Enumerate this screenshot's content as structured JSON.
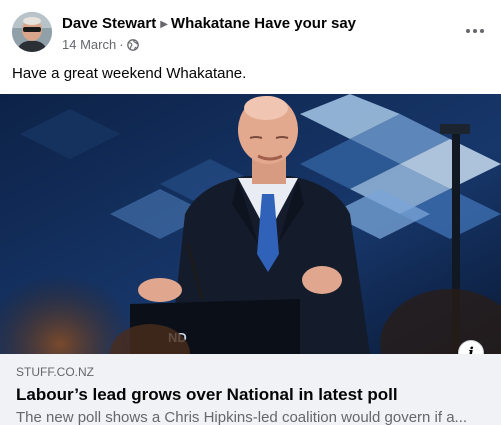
{
  "post": {
    "author": "Dave Stewart",
    "group": "Whakatane Have your say",
    "date": "14 March",
    "separator": "·",
    "privacy_icon": "globe-icon",
    "text": "Have a great weekend Whakatane."
  },
  "link_preview": {
    "domain": "STUFF.CO.NZ",
    "title": "Labour’s lead grows over National in latest poll",
    "description": "The new poll shows a Chris Hipkins-led coalition would govern if a...",
    "image_caption": "ND"
  },
  "icons": {
    "more": "more-options-icon",
    "info": "info-icon"
  },
  "colors": {
    "secondary_text": "#65676b",
    "link_meta_bg": "#f0f2f5",
    "primary_text": "#050505"
  }
}
